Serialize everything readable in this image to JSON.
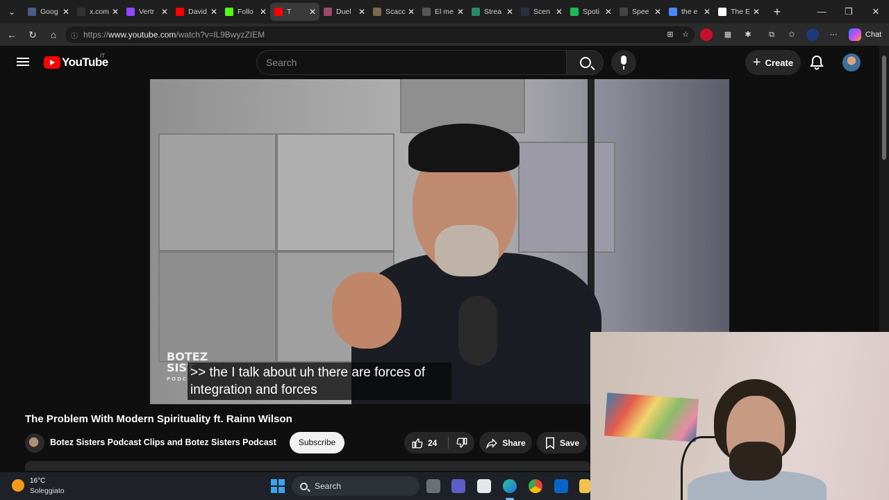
{
  "browser": {
    "tabs": [
      {
        "title": "Goog",
        "color": "#4a5c8a",
        "active": false
      },
      {
        "title": "x.com",
        "color": "#333333",
        "active": false
      },
      {
        "title": "Vertr",
        "color": "#9146ff",
        "active": false
      },
      {
        "title": "David",
        "color": "#ff0000",
        "active": false
      },
      {
        "title": "Follo",
        "color": "#53fc18",
        "active": false
      },
      {
        "title": "T",
        "color": "#ff0000",
        "active": true
      },
      {
        "title": "Duel",
        "color": "#a04a6a",
        "active": false
      },
      {
        "title": "Scacc",
        "color": "#7a6a4a",
        "active": false
      },
      {
        "title": "El me",
        "color": "#555555",
        "active": false
      },
      {
        "title": "Strea",
        "color": "#2a8a6a",
        "active": false
      },
      {
        "title": "Scen",
        "color": "#2a2f45",
        "active": false
      },
      {
        "title": "Spoti",
        "color": "#1db954",
        "active": false
      },
      {
        "title": "Spee",
        "color": "#444444",
        "active": false
      },
      {
        "title": "the e",
        "color": "#4a88ff",
        "active": false
      },
      {
        "title": "The E",
        "color": "#ffffff",
        "active": false
      }
    ],
    "url_prefix": "https://",
    "url_host": "www.youtube.com",
    "url_path": "/watch?v=lL9BwyzZIEM",
    "chat_label": "Chat"
  },
  "youtube": {
    "logo_text": "YouTube",
    "country_code": "IT",
    "search_placeholder": "Search",
    "create_label": "Create"
  },
  "video": {
    "watermark_line1": "BOTEZ",
    "watermark_line2": "SIST",
    "watermark_line3": "PODC",
    "caption_line1": ">> the I talk about uh there are forces of",
    "caption_line2": "integration and forces",
    "title": "The Problem With Modern Spirituality ft. Rainn Wilson",
    "channel": "Botez Sisters Podcast Clips and Botez Sisters Podcast",
    "subscribe_label": "Subscribe",
    "likes": "24",
    "share_label": "Share",
    "save_label": "Save"
  },
  "taskbar": {
    "temperature": "16°C",
    "condition": "Soleggiato",
    "search_label": "Search"
  }
}
